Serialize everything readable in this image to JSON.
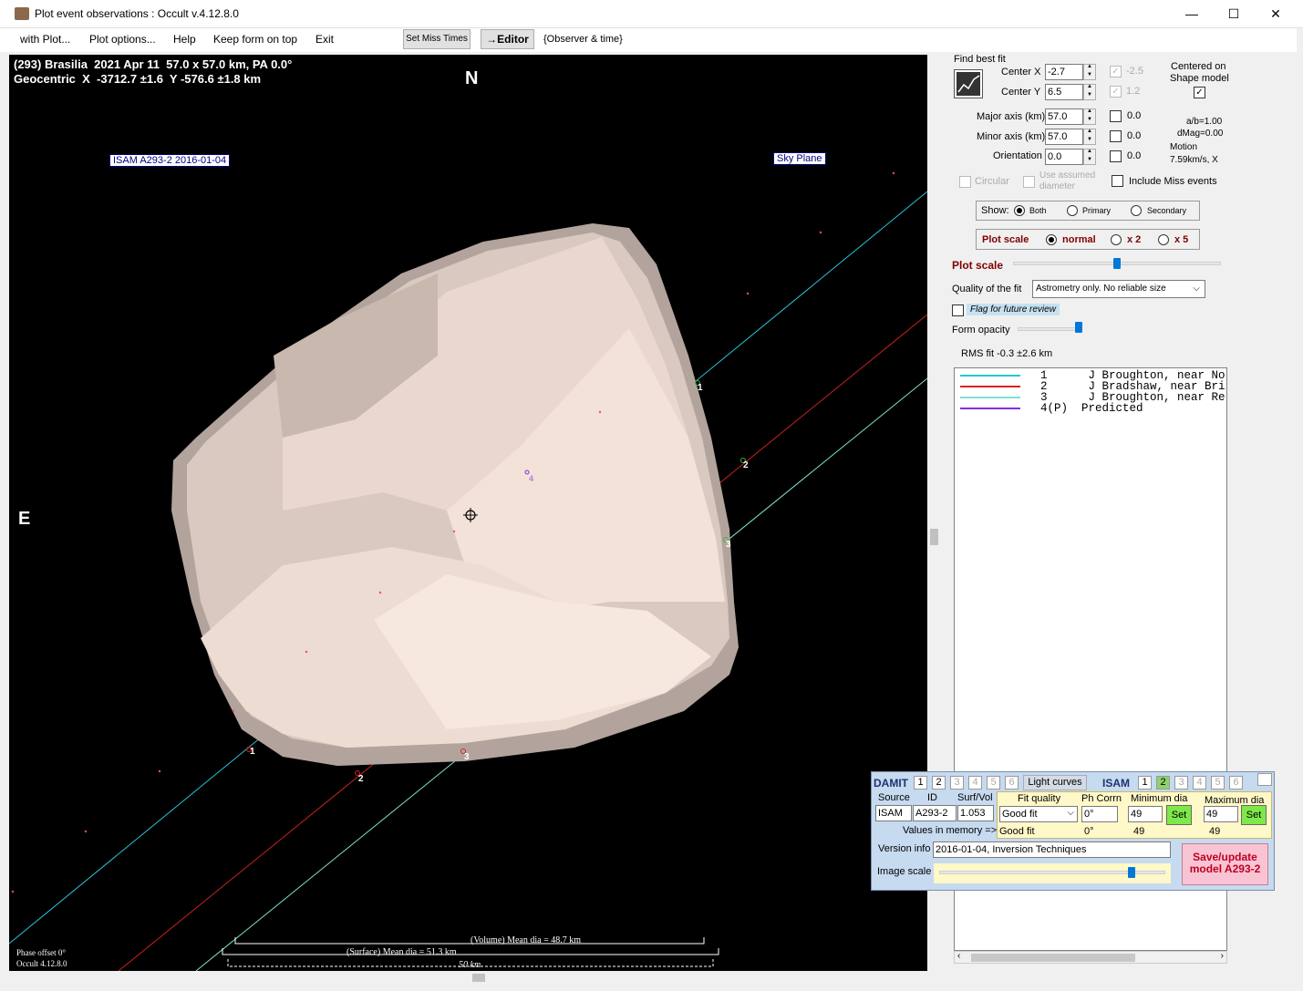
{
  "window": {
    "title": "Plot event observations : Occult v.4.12.8.0",
    "minimize": "—",
    "maximize": "☐",
    "close": "✕"
  },
  "menu": {
    "items": [
      "with Plot...",
      "Plot options...",
      "Help",
      "Keep form on top",
      "Exit"
    ],
    "set_miss_times": "Set Miss Times",
    "editor": "→Editor",
    "observer_time": "{Observer & time}"
  },
  "plot": {
    "header_line1": "(293) Brasilia  2021 Apr 11  57.0 x 57.0 km, PA 0.0°",
    "header_line2": "Geocentric  X  -3712.7 ±1.6  Y -576.6 ±1.8 km",
    "north": "N",
    "east": "E",
    "model_label": "ISAM A293-2 2016-01-04",
    "sky_plane": "Sky Plane",
    "chord_labels_top": [
      "1",
      "2",
      "3"
    ],
    "chord_labels_bottom": [
      "1",
      "2",
      "3"
    ],
    "predicted_label": "4",
    "phase_offset": "Phase offset 0°",
    "occult_version": "Occult 4.12.8.0",
    "volume_dia": "(Volume) Mean dia = 48.7 km",
    "surface_dia": "(Surface) Mean dia = 51.3 km",
    "scale_bar": "50 km",
    "colors": {
      "cyan": "#29c4d8",
      "red": "#cc2020",
      "light_cyan": "#7fe0d0"
    }
  },
  "fit": {
    "find_best_fit": "Find best fit",
    "center_x_label": "Center X",
    "center_x": "-2.7",
    "center_x_fixed": "-2.5",
    "center_y_label": "Center Y",
    "center_y": "6.5",
    "center_y_fixed": "1.2",
    "major_label": "Major axis (km)",
    "major": "57.0",
    "major_fixed": "0.0",
    "minor_label": "Minor axis (km)",
    "minor": "57.0",
    "minor_fixed": "0.0",
    "orient_label": "Orientation",
    "orient": "0.0",
    "orient_fixed": "0.0",
    "centered_on": "Centered on",
    "shape_model": "Shape model",
    "ab_ratio": "a/b=1.00",
    "dmag": "dMag=0.00",
    "motion": "Motion",
    "motion_value": "7.59km/s, X",
    "circular": "Circular",
    "use_assumed": "Use assumed",
    "diameter": "diameter",
    "include_miss": "Include Miss events"
  },
  "show": {
    "label": "Show:",
    "options": [
      "Both",
      "Primary",
      "Secondary"
    ]
  },
  "plot_scale": {
    "label": "Plot scale",
    "options": [
      "normal",
      "x 2",
      "x 5"
    ],
    "slider_label": "Plot scale",
    "slider_value": 0.5
  },
  "quality": {
    "label": "Quality of the fit",
    "value": "Astrometry only. No reliable size"
  },
  "flag_review": "Flag for future review",
  "form_opacity": {
    "label": "Form opacity",
    "value": 0.95
  },
  "rms": "RMS fit -0.3 ±2.6 km",
  "legend": [
    {
      "text": "1      J Broughton, near No",
      "color": "#29c4d8"
    },
    {
      "text": "2      J Bradshaw, near Bri",
      "color": "#dd2020"
    },
    {
      "text": "3      J Broughton, near Re",
      "color": "#7fe0d0"
    },
    {
      "text": "4(P)  Predicted",
      "color": "#8a2be2"
    }
  ],
  "damit": {
    "damit_label": "DAMIT",
    "damit_nums": [
      "1",
      "2",
      "3",
      "4",
      "5",
      "6"
    ],
    "light_curves": "Light curves",
    "isam_label": "ISAM",
    "isam_nums": [
      "1",
      "2",
      "3",
      "4",
      "5",
      "6"
    ],
    "source_label": "Source",
    "id_label": "ID",
    "surfvol_label": "Surf/Vol",
    "fit_quality_label": "Fit quality",
    "ph_corr_label": "Ph Corrn",
    "min_dia_label": "Minimum dia",
    "max_dia_label": "Maximum dia",
    "source": "ISAM",
    "id": "A293-2",
    "surfvol": "1.053",
    "fit_quality": "Good fit",
    "ph_corr": "0°",
    "min_dia": "49",
    "max_dia": "49",
    "set": "Set",
    "values_in_memory": "Values in memory =>",
    "mem_fit": "Good fit",
    "mem_ph": "0°",
    "mem_min": "49",
    "mem_max": "49",
    "version_label": "Version info",
    "version": "2016-01-04, Inversion Techniques",
    "image_scale": "Image scale",
    "save_line1": "Save/update",
    "save_line2": "model A293-2"
  }
}
